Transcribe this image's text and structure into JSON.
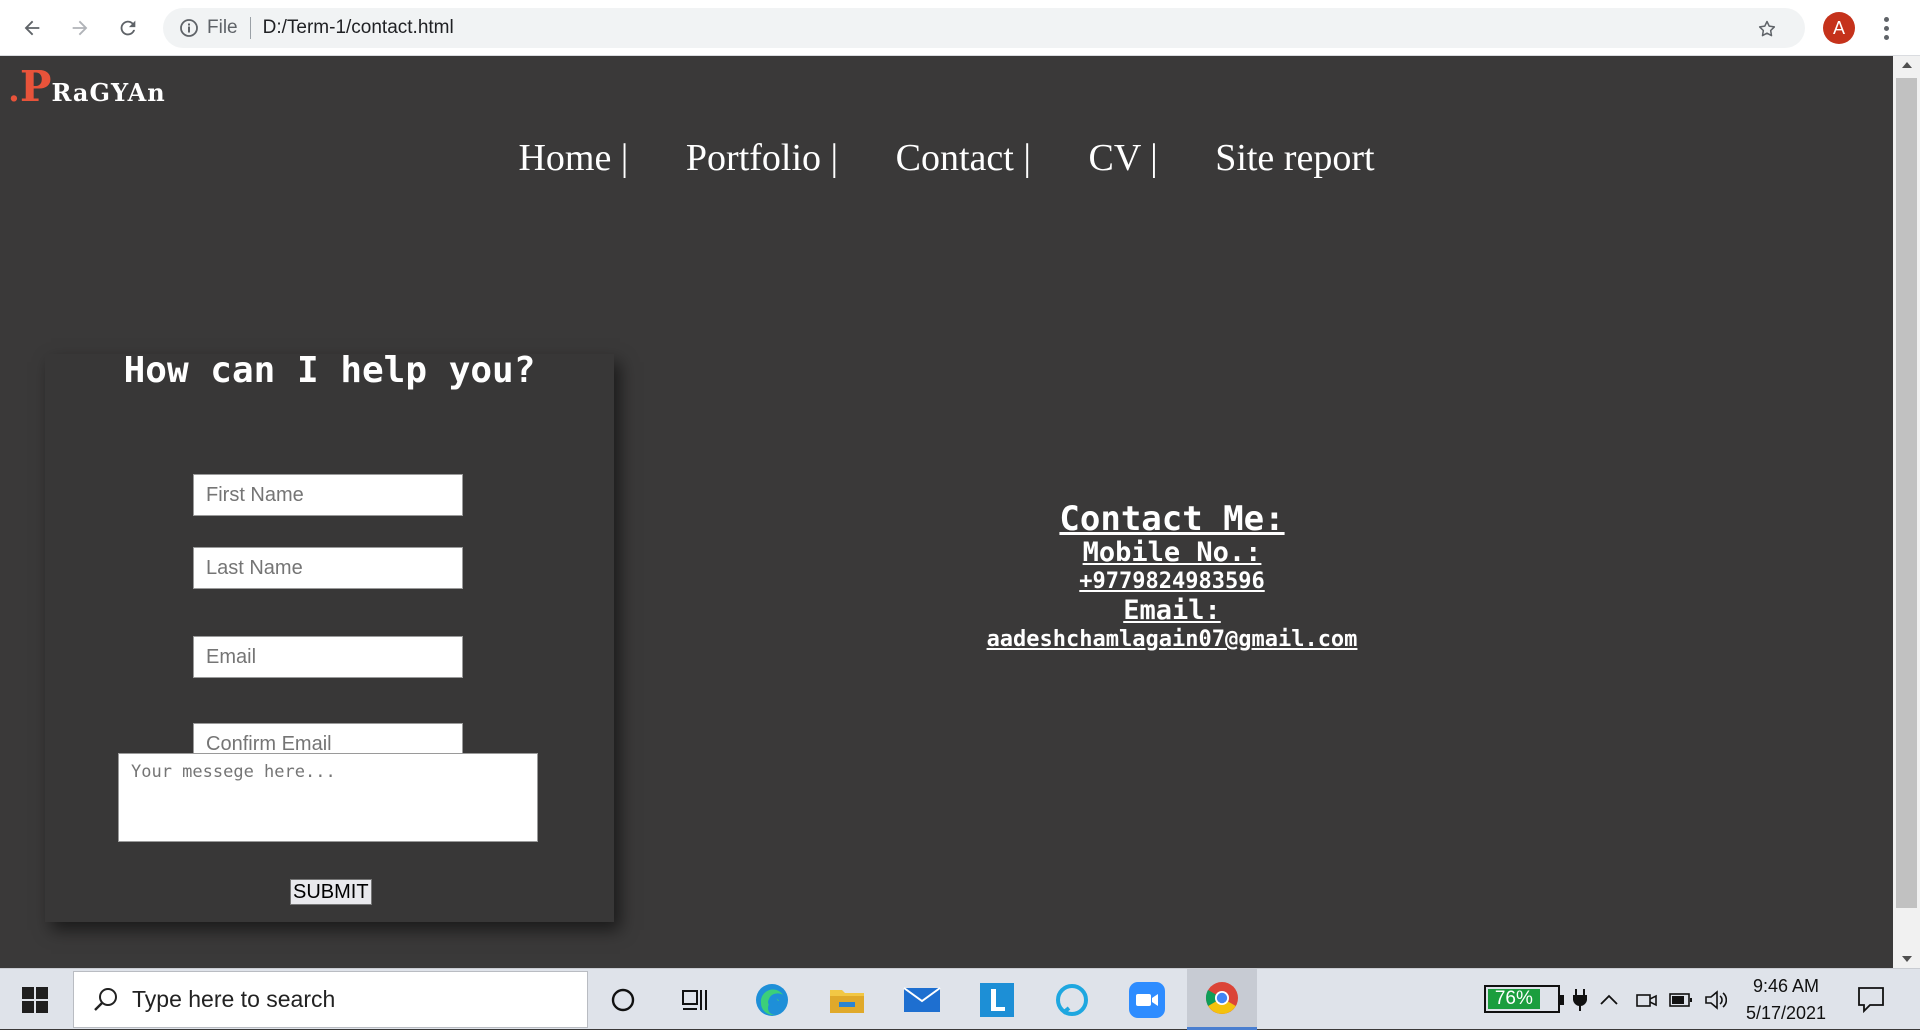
{
  "browser": {
    "scheme": "File",
    "url": "D:/Term-1/contact.html",
    "profile_initial": "A"
  },
  "site": {
    "logo_dot": ".",
    "logo_big": "P",
    "logo_rest": "RaGYAn",
    "nav": [
      "Home |",
      "Portfolio |",
      "Contact |",
      "CV |",
      "Site report"
    ]
  },
  "form": {
    "title": "How can I help you?",
    "first_name_placeholder": "First Name",
    "last_name_placeholder": "Last Name",
    "email_placeholder": "Email",
    "confirm_email_placeholder": "Confirm Email",
    "message_placeholder": "Your messege here...",
    "submit_label": "SUBMIT"
  },
  "contact": {
    "heading": "Contact Me:",
    "mobile_label": "Mobile No.:",
    "mobile_value": "+9779824983596",
    "email_label": "Email:",
    "email_value": "aadeshchamlagain07@gmail.com"
  },
  "taskbar": {
    "search_placeholder": "Type here to search",
    "battery_percent": "76%",
    "battery_level": 0.76,
    "time": "9:46 AM",
    "date": "5/17/2021"
  },
  "colors": {
    "page_bg": "#3a3939",
    "logo_accent": "#e8533a",
    "avatar": "#c5321b",
    "battery": "#1b9e3e"
  }
}
